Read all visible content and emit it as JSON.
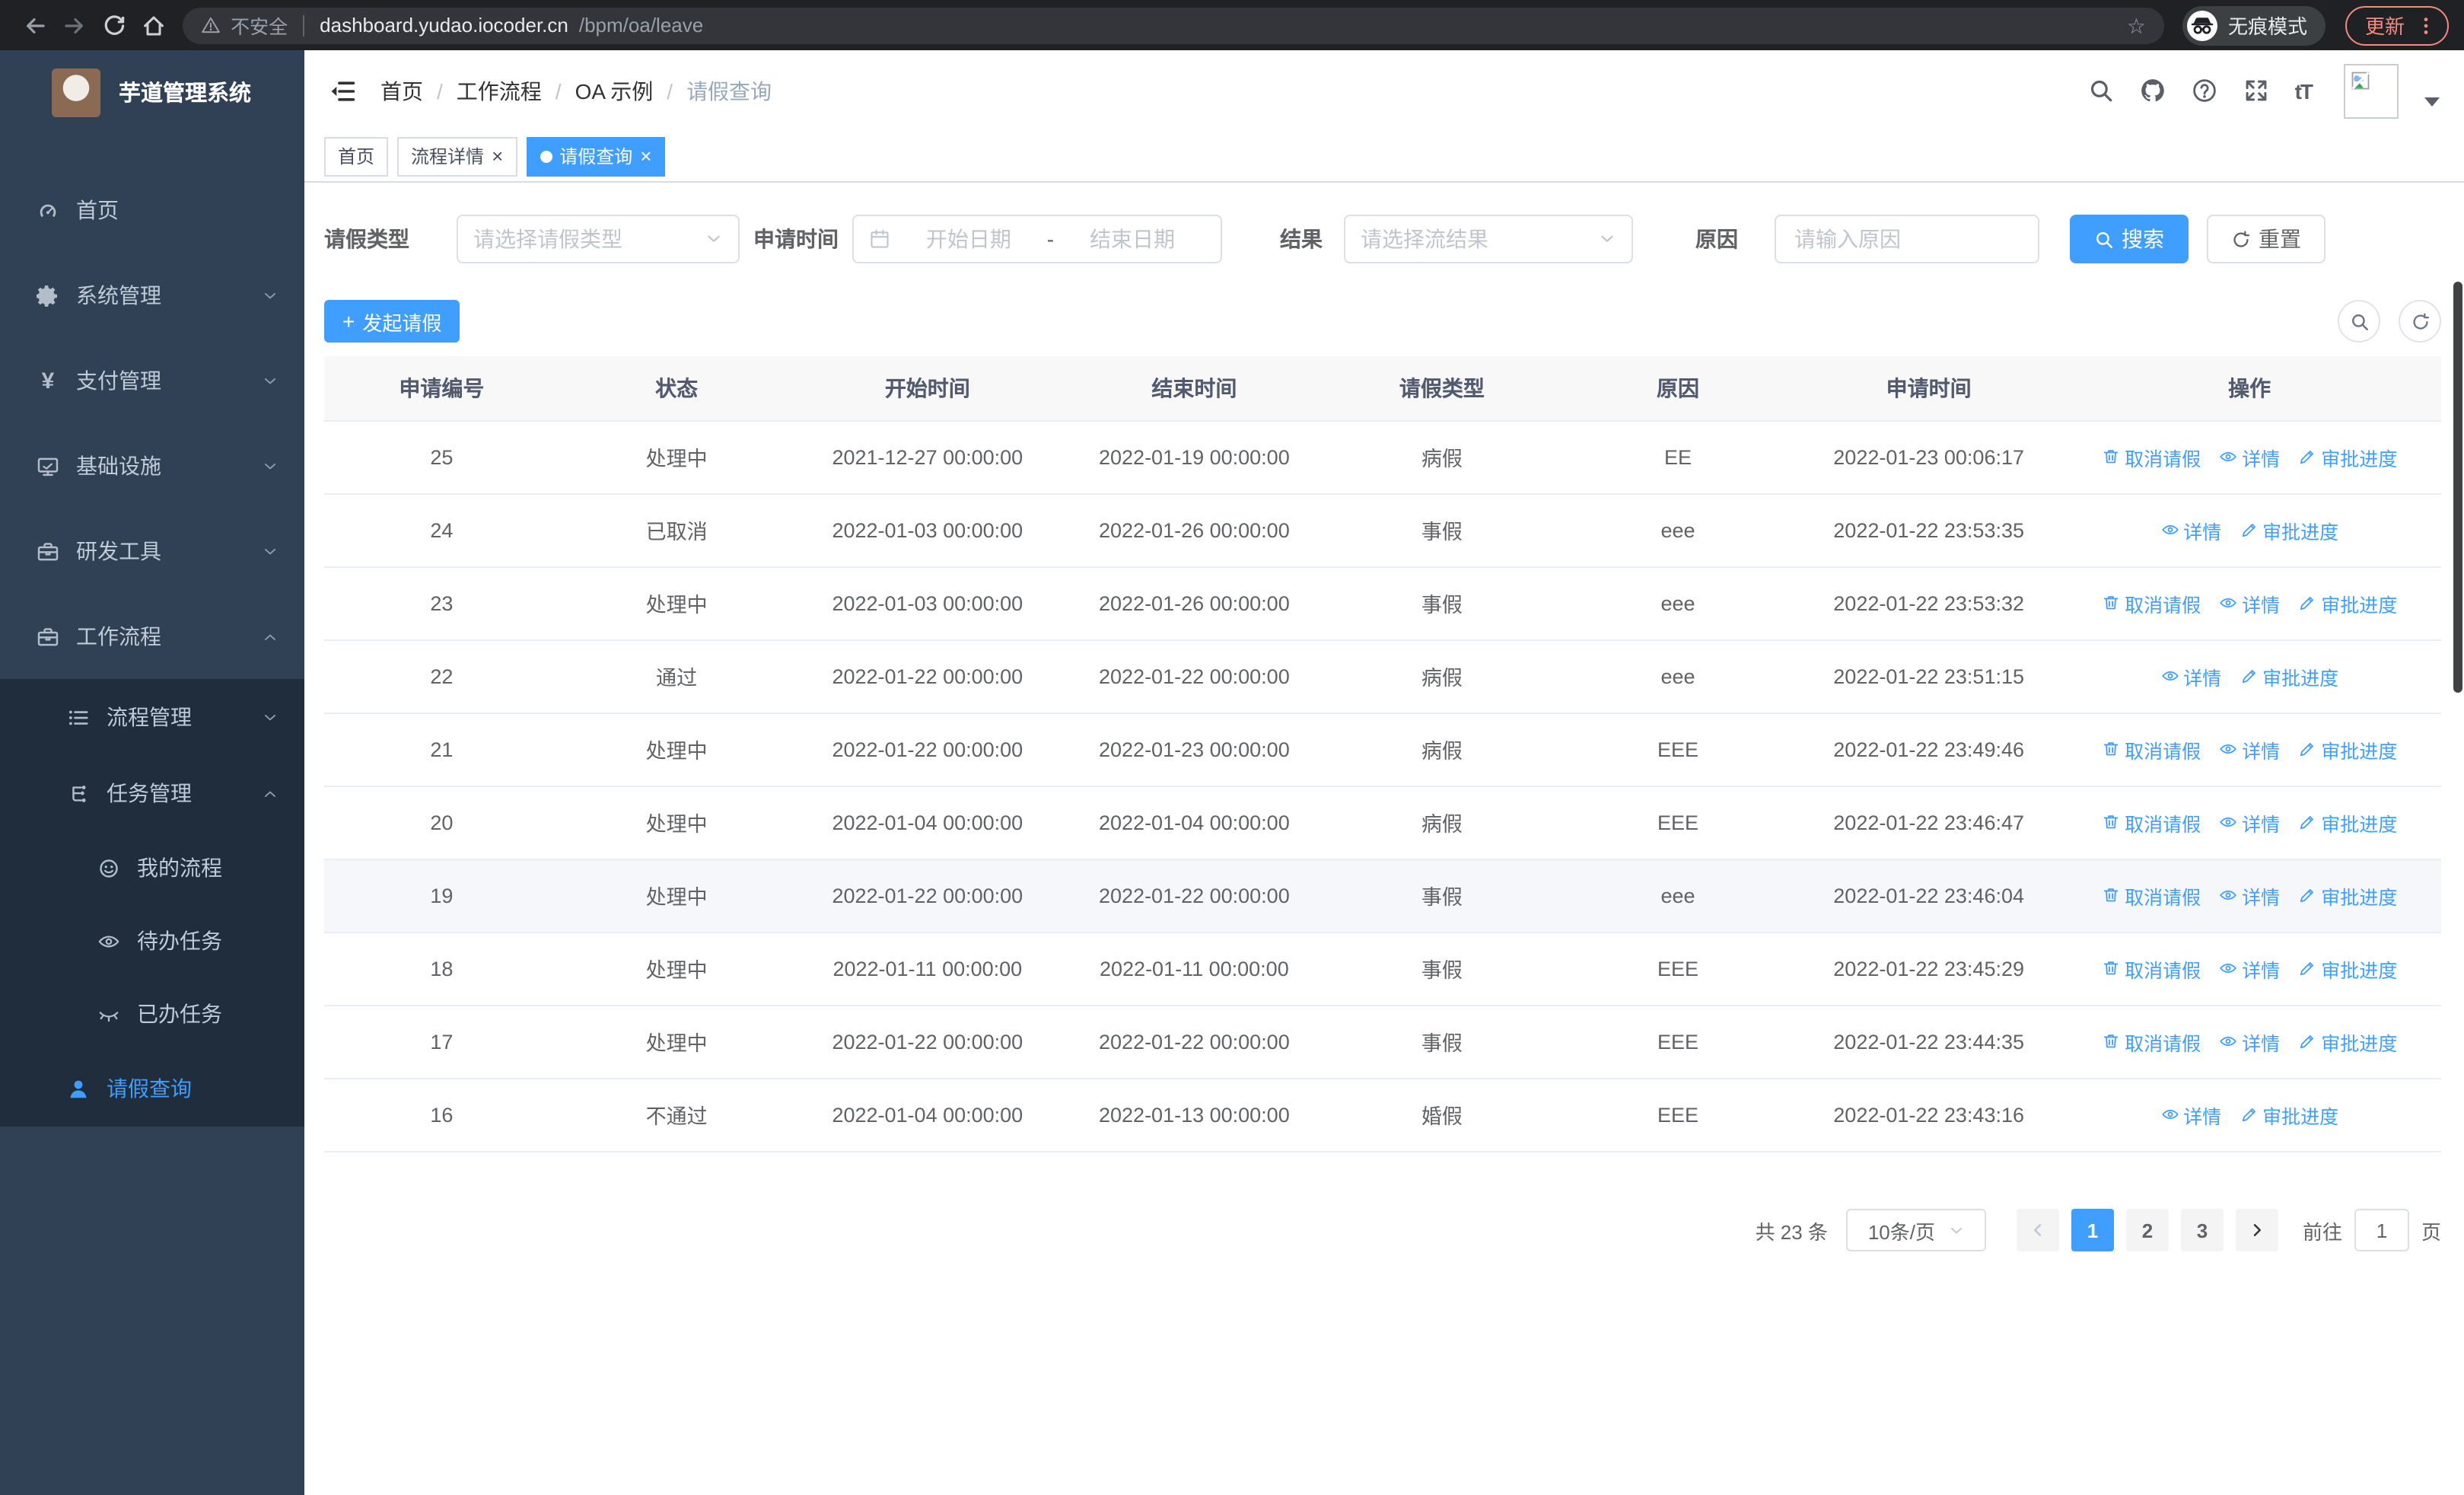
{
  "icons": {
    "yen_glyph": "¥",
    "close_glyph": "×",
    "star_glyph": "☆",
    "font_size_glyph": "tT",
    "question_glyph": "?",
    "plus_glyph": "+"
  },
  "browser": {
    "not_secure": "不安全",
    "url_host": "dashboard.yudao.iocoder.cn",
    "url_path": "/bpm/oa/leave",
    "incognito": "无痕模式",
    "update": "更新"
  },
  "sidebar": {
    "title": "芋道管理系统",
    "items_top": [
      {
        "name": "home",
        "icon": "gauge",
        "label": "首页",
        "indent": 24
      },
      {
        "name": "system-management",
        "icon": "gear",
        "label": "系统管理",
        "indent": 24,
        "chevron": "down"
      },
      {
        "name": "payment-management",
        "icon": "yen",
        "label": "支付管理",
        "indent": 24,
        "chevron": "down"
      },
      {
        "name": "infrastructure",
        "icon": "monitor",
        "label": "基础设施",
        "indent": 24,
        "chevron": "down"
      },
      {
        "name": "dev-tools",
        "icon": "briefcase",
        "label": "研发工具",
        "indent": 24,
        "chevron": "down"
      },
      {
        "name": "workflow",
        "icon": "briefcase",
        "label": "工作流程",
        "indent": 24,
        "chevron": "up"
      }
    ],
    "items_sub": [
      {
        "name": "process-management",
        "icon": "list",
        "label": "流程管理",
        "indent": 44,
        "chevron": "down"
      },
      {
        "name": "task-management",
        "icon": "flow",
        "label": "任务管理",
        "indent": 44,
        "chevron": "up"
      },
      {
        "name": "my-process",
        "icon": "robot",
        "label": "我的流程",
        "indent": 64
      },
      {
        "name": "todo-tasks",
        "icon": "eye",
        "label": "待办任务",
        "indent": 64
      },
      {
        "name": "done-tasks",
        "icon": "eye-closed",
        "label": "已办任务",
        "indent": 64
      },
      {
        "name": "leave-query",
        "icon": "person",
        "label": "请假查询",
        "indent": 44,
        "active": true
      }
    ]
  },
  "header": {
    "breadcrumb": [
      "首页",
      "工作流程",
      "OA 示例",
      "请假查询"
    ],
    "separator": "/"
  },
  "tabs": [
    {
      "name": "home",
      "label": "首页"
    },
    {
      "name": "process-detail",
      "label": "流程详情",
      "closable": true
    },
    {
      "name": "leave-query",
      "label": "请假查询",
      "closable": true,
      "active": true
    }
  ],
  "filters": {
    "leave_type_label": "请假类型",
    "leave_type_placeholder": "请选择请假类型",
    "apply_time_label": "申请时间",
    "start_date_placeholder": "开始日期",
    "date_separator": "-",
    "end_date_placeholder": "结束日期",
    "result_label": "结果",
    "result_placeholder": "请选择流结果",
    "reason_label": "原因",
    "reason_placeholder": "请输入原因",
    "search_label": "搜索",
    "reset_label": "重置"
  },
  "toolbar": {
    "create_label": "发起请假"
  },
  "table": {
    "columns": [
      "申请编号",
      "状态",
      "开始时间",
      "结束时间",
      "请假类型",
      "原因",
      "申请时间",
      "操作"
    ],
    "rows": [
      {
        "id": "25",
        "status": "处理中",
        "start": "2021-12-27 00:00:00",
        "end": "2022-01-19 00:00:00",
        "type": "病假",
        "reason": "EE",
        "applied": "2022-01-23 00:06:17",
        "actions": [
          "取消请假",
          "详情",
          "审批进度"
        ]
      },
      {
        "id": "24",
        "status": "已取消",
        "start": "2022-01-03 00:00:00",
        "end": "2022-01-26 00:00:00",
        "type": "事假",
        "reason": "eee",
        "applied": "2022-01-22 23:53:35",
        "actions": [
          "详情",
          "审批进度"
        ]
      },
      {
        "id": "23",
        "status": "处理中",
        "start": "2022-01-03 00:00:00",
        "end": "2022-01-26 00:00:00",
        "type": "事假",
        "reason": "eee",
        "applied": "2022-01-22 23:53:32",
        "actions": [
          "取消请假",
          "详情",
          "审批进度"
        ]
      },
      {
        "id": "22",
        "status": "通过",
        "start": "2022-01-22 00:00:00",
        "end": "2022-01-22 00:00:00",
        "type": "病假",
        "reason": "eee",
        "applied": "2022-01-22 23:51:15",
        "actions": [
          "详情",
          "审批进度"
        ]
      },
      {
        "id": "21",
        "status": "处理中",
        "start": "2022-01-22 00:00:00",
        "end": "2022-01-23 00:00:00",
        "type": "病假",
        "reason": "EEE",
        "applied": "2022-01-22 23:49:46",
        "actions": [
          "取消请假",
          "详情",
          "审批进度"
        ]
      },
      {
        "id": "20",
        "status": "处理中",
        "start": "2022-01-04 00:00:00",
        "end": "2022-01-04 00:00:00",
        "type": "病假",
        "reason": "EEE",
        "applied": "2022-01-22 23:46:47",
        "actions": [
          "取消请假",
          "详情",
          "审批进度"
        ]
      },
      {
        "id": "19",
        "status": "处理中",
        "start": "2022-01-22 00:00:00",
        "end": "2022-01-22 00:00:00",
        "type": "事假",
        "reason": "eee",
        "applied": "2022-01-22 23:46:04",
        "actions": [
          "取消请假",
          "详情",
          "审批进度"
        ],
        "hover": true
      },
      {
        "id": "18",
        "status": "处理中",
        "start": "2022-01-11 00:00:00",
        "end": "2022-01-11 00:00:00",
        "type": "事假",
        "reason": "EEE",
        "applied": "2022-01-22 23:45:29",
        "actions": [
          "取消请假",
          "详情",
          "审批进度"
        ]
      },
      {
        "id": "17",
        "status": "处理中",
        "start": "2022-01-22 00:00:00",
        "end": "2022-01-22 00:00:00",
        "type": "事假",
        "reason": "EEE",
        "applied": "2022-01-22 23:44:35",
        "actions": [
          "取消请假",
          "详情",
          "审批进度"
        ]
      },
      {
        "id": "16",
        "status": "不通过",
        "start": "2022-01-04 00:00:00",
        "end": "2022-01-13 00:00:00",
        "type": "婚假",
        "reason": "EEE",
        "applied": "2022-01-22 23:43:16",
        "actions": [
          "详情",
          "审批进度"
        ]
      }
    ]
  },
  "pagination": {
    "total": "共 23 条",
    "page_size": "10条/页",
    "pages": [
      "1",
      "2",
      "3"
    ],
    "active_page": "1",
    "goto_label": "前往",
    "goto_value": "1",
    "goto_unit": "页"
  }
}
